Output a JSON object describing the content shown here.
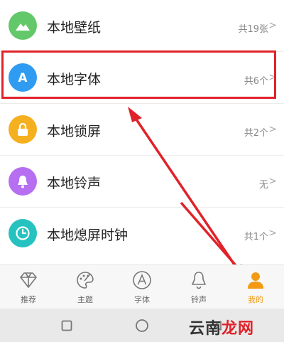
{
  "list": {
    "items": [
      {
        "label": "本地壁纸",
        "count": "共19张",
        "icon": "mountain-icon",
        "color": "#63c86a"
      },
      {
        "label": "本地字体",
        "count": "共6个",
        "icon": "letter-a-icon",
        "color": "#2f9cf2"
      },
      {
        "label": "本地锁屏",
        "count": "共2个",
        "icon": "lock-icon",
        "color": "#f5b020"
      },
      {
        "label": "本地铃声",
        "count": "无",
        "icon": "bell-icon",
        "color": "#b56ff0"
      },
      {
        "label": "本地熄屏时钟",
        "count": "共1个",
        "icon": "clock-icon",
        "color": "#26c2c0"
      }
    ]
  },
  "tabbar": {
    "tabs": [
      {
        "label": "推荐",
        "icon": "diamond-icon"
      },
      {
        "label": "主题",
        "icon": "palette-icon"
      },
      {
        "label": "字体",
        "icon": "letter-a-outline-icon"
      },
      {
        "label": "铃声",
        "icon": "bell-outline-icon"
      },
      {
        "label": "我的",
        "icon": "person-icon",
        "active": true
      }
    ],
    "active_color": "#f39a14"
  },
  "navbar": {
    "buttons": [
      "recent-apps-icon",
      "home-icon",
      "back-icon"
    ]
  },
  "watermark": {
    "part1": "云南",
    "part2": "龙网"
  },
  "highlight_color": "#e0222a"
}
